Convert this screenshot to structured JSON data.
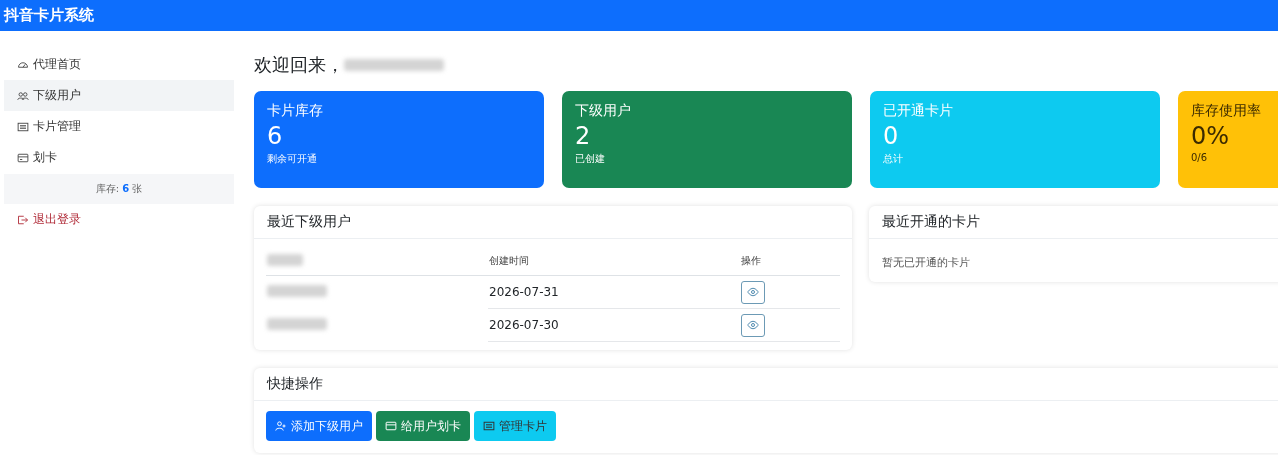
{
  "app_title": "抖音卡片系统",
  "sidebar": {
    "items": [
      {
        "label": "代理首页",
        "selected": false
      },
      {
        "label": "下级用户",
        "selected": true
      },
      {
        "label": "卡片管理",
        "selected": false
      },
      {
        "label": "划卡",
        "selected": false
      }
    ],
    "stock_note": "库存: **6** 张",
    "logout": "退出登录"
  },
  "greeting": "欢迎回来，",
  "stats": [
    {
      "title": "卡片库存",
      "value": "6",
      "note": "剩余可开通",
      "color": "#0d6efd",
      "dark_text": false
    },
    {
      "title": "下级用户",
      "value": "2",
      "note": "已创建",
      "color": "#198754",
      "dark_text": false
    },
    {
      "title": "已开通卡片",
      "value": "0",
      "note": "总计",
      "color": "#0dcaf0",
      "dark_text": false
    },
    {
      "title": "库存使用率",
      "value": "0%",
      "note": "0/6",
      "color": "#ffc107",
      "dark_text": true
    }
  ],
  "recent_users": {
    "title": "最近下级用户",
    "columns": [
      "创建时间",
      "操作"
    ],
    "rows": [
      {
        "created": "2026-07-31"
      },
      {
        "created": "2026-07-30"
      }
    ]
  },
  "recent_cards": {
    "title": "最近开通的卡片",
    "empty": "暂无已开通的卡片"
  },
  "quick_actions": {
    "title": "快捷操作",
    "buttons": [
      {
        "label": "添加下级用户",
        "color": "#0d6efd"
      },
      {
        "label": "给用户划卡",
        "color": "#198754"
      },
      {
        "label": "管理卡片",
        "color": "#0dcaf0"
      }
    ]
  }
}
